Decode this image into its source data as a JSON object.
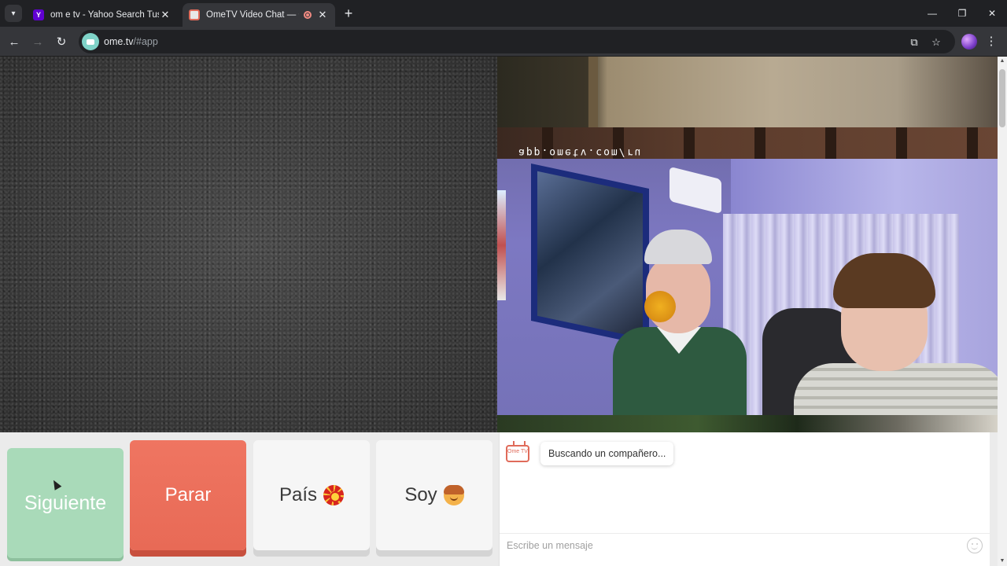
{
  "browser": {
    "tabs": [
      {
        "title": "om e tv - Yahoo Search Tus resultados",
        "favicon": "yahoo-icon",
        "active": false
      },
      {
        "title": "OmeTV Video Chat — Omegle",
        "favicon": "ometv-icon",
        "active": true,
        "recording": true
      }
    ],
    "address": {
      "host": "ome.tv",
      "path": "/#app"
    },
    "icons": {
      "tab_search": "▾",
      "close": "✕",
      "new_tab": "+",
      "minimize": "—",
      "maximize": "❐",
      "win_close": "✕",
      "back": "←",
      "forward": "→",
      "reload": "↻",
      "cast": "⧉",
      "bookmark": "☆",
      "menu": "⋮"
    }
  },
  "video": {
    "self_watermark": "app.ometv.com/ru"
  },
  "controls": {
    "next_label": "Siguiente",
    "stop_label": "Parar",
    "country_label": "País",
    "gender_label": "Soy"
  },
  "chat": {
    "logo_text": "Ome TV",
    "status_message": "Buscando un compañero...",
    "input_placeholder": "Escribe un mensaje"
  },
  "colors": {
    "next": "#a9dab9",
    "stop": "#e86a56",
    "neutral": "#f6f6f6",
    "brand": "#e06b5a"
  }
}
